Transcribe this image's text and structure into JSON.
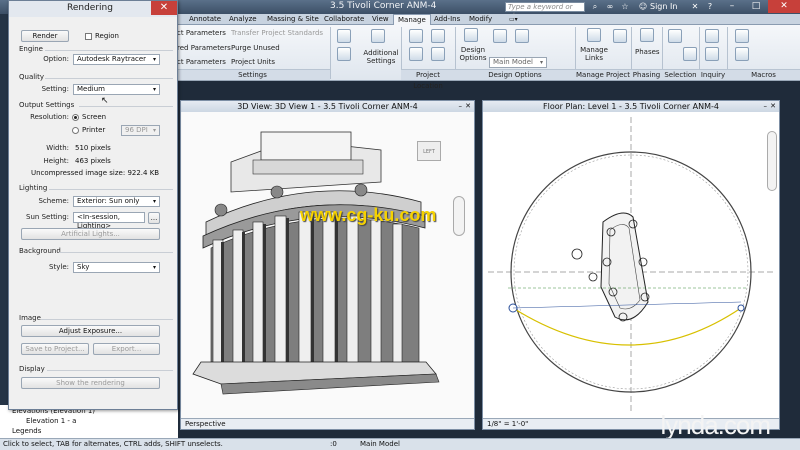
{
  "window": {
    "title": "3.5 Tivoli Corner ANM-4",
    "search_placeholder": "Type a keyword or phrase",
    "sign_in": "Sign In"
  },
  "ribbon": {
    "tabs": [
      "Annotate",
      "Analyze",
      "Massing & Site",
      "Collaborate",
      "View",
      "Manage",
      "Add-Ins",
      "Modify"
    ],
    "active_tab": "Manage",
    "settings_items": [
      "ct Parameters",
      "red Parameters",
      "ct Parameters"
    ],
    "settings_items2": [
      "Transfer Project Standards",
      "Purge Unused",
      "Project Units"
    ],
    "additional_settings": "Additional Settings",
    "design_options": "Design Options",
    "main_model": "Main Model",
    "manage_links": "Manage Links",
    "phases": "Phases",
    "groups": {
      "settings": "Settings",
      "project_location": "Project Location",
      "design_options": "Design Options",
      "manage_project": "Manage Project",
      "phasing": "Phasing",
      "selection": "Selection",
      "inquiry": "Inquiry",
      "macros": "Macros"
    }
  },
  "dialog": {
    "title": "Rendering",
    "render": "Render",
    "region": "Region",
    "engine_label": "Engine",
    "option_label": "Option:",
    "option_value": "Autodesk Raytracer",
    "quality_label": "Quality",
    "setting_label": "Setting:",
    "setting_value": "Medium",
    "output_label": "Output Settings",
    "resolution_label": "Resolution:",
    "screen": "Screen",
    "printer": "Printer",
    "dpi": "96 DPI",
    "width_label": "Width:",
    "width_value": "510 pixels",
    "height_label": "Height:",
    "height_value": "463 pixels",
    "image_size": "Uncompressed image size: 922.4 KB",
    "lighting_label": "Lighting",
    "scheme_label": "Scheme:",
    "scheme_value": "Exterior: Sun only",
    "sun_label": "Sun Setting:",
    "sun_value": "<In-session, Lighting>",
    "sun_more": "...",
    "artificial_lights": "Artificial Lights...",
    "background_label": "Background",
    "style_label": "Style:",
    "style_value": "Sky",
    "image_label": "Image",
    "adjust_exposure": "Adjust Exposure...",
    "save_to_project": "Save to Project...",
    "export": "Export...",
    "display_label": "Display",
    "show_rendering": "Show the rendering"
  },
  "views": {
    "left_title": "3D View: 3D View 1 - 3.5 Tivoli Corner ANM-4",
    "left_footer": "Perspective",
    "right_title": "Floor Plan: Level 1 - 3.5 Tivoli Corner ANM-4",
    "right_footer": "1/8\" = 1'-0\"",
    "viewcube_label": "LEFT"
  },
  "tree": {
    "items": [
      "Elevations (Elevation 1)",
      "Elevation 1 - a",
      "Legends"
    ]
  },
  "status": {
    "text": "Click to select, TAB for alternates, CTRL adds, SHIFT unselects.",
    "model": "Main Model",
    "zoom": ":0"
  },
  "watermark": {
    "site": "www.cg-ku.com",
    "brand": "lynda.com"
  }
}
